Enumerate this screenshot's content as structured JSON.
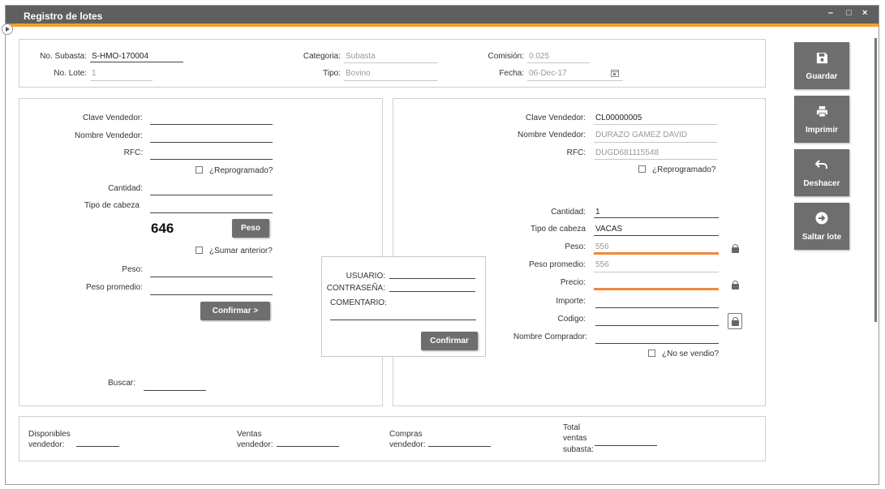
{
  "window": {
    "title": "Registro de lotes",
    "controls": [
      "–",
      "□",
      "×"
    ]
  },
  "header": {
    "no_subasta_label": "No. Subasta:",
    "no_subasta_value": "S-HMO-170004",
    "no_lote_label": "No. Lote:",
    "no_lote_value": "1",
    "categoria_label": "Categoria:",
    "categoria_value": "Subasta",
    "tipo_label": "Tipo:",
    "tipo_value": "Bovino",
    "comision_label": "Comisión:",
    "comision_value": "0.025",
    "fecha_label": "Fecha:",
    "fecha_value": "06-Dec-17"
  },
  "left": {
    "clave_vendedor_label": "Clave Vendedor:",
    "nombre_vendedor_label": "Nombre Vendedor:",
    "rfc_label": "RFC:",
    "reprogramado_label": "¿Reprogramado?",
    "cantidad_label": "Cantidad:",
    "tipo_cabeza_label": "Tipo de cabeza",
    "peso_counter": "646",
    "peso_button": "Peso",
    "sumar_anterior_label": "¿Sumar anterior?",
    "peso_label": "Peso:",
    "peso_promedio_label": "Peso promedio:",
    "confirmar_button": "Confirmar  >",
    "buscar_label": "Buscar:"
  },
  "popup": {
    "usuario_label": "USUARIO:",
    "contrasena_label": "CONTRASEÑA:",
    "comentario_label": "COMENTARIO:",
    "confirmar_button": "Confirmar"
  },
  "right": {
    "clave_vendedor_label": "Clave Vendedor:",
    "clave_vendedor_value": "CL00000005",
    "nombre_vendedor_label": "Nombre Vendedor:",
    "nombre_vendedor_value": "DURAZO GAMEZ DAVID",
    "rfc_label": "RFC:",
    "rfc_value": "DUGD681115548",
    "reprogramado_label": "¿Reprogramado?",
    "cantidad_label": "Cantidad:",
    "cantidad_value": "1",
    "tipo_cabeza_label": "Tipo de cabeza",
    "tipo_cabeza_value": "VACAS",
    "peso_label": "Peso:",
    "peso_value": "556",
    "peso_promedio_label": "Peso promedio:",
    "peso_promedio_value": "556",
    "precio_label": "Precio:",
    "importe_label": "Importe:",
    "codigo_label": "Codigo:",
    "nombre_comprador_label": "Nombre Comprador:",
    "no_se_vendio_label": "¿No se vendio?"
  },
  "footer": {
    "disponibles_line1": "Disponibles",
    "disponibles_line2": "vendedor:",
    "ventas_line1": "Ventas",
    "ventas_line2": "vendedor:",
    "compras_line1": "Compras",
    "compras_line2": "vendedor:",
    "total_line1": "Total",
    "total_line2": "ventas",
    "total_line3": "subasta:"
  },
  "sidebar": {
    "guardar": "Guardar",
    "imprimir": "Imprimir",
    "deshacer": "Deshacer",
    "saltar": "Saltar lote"
  }
}
